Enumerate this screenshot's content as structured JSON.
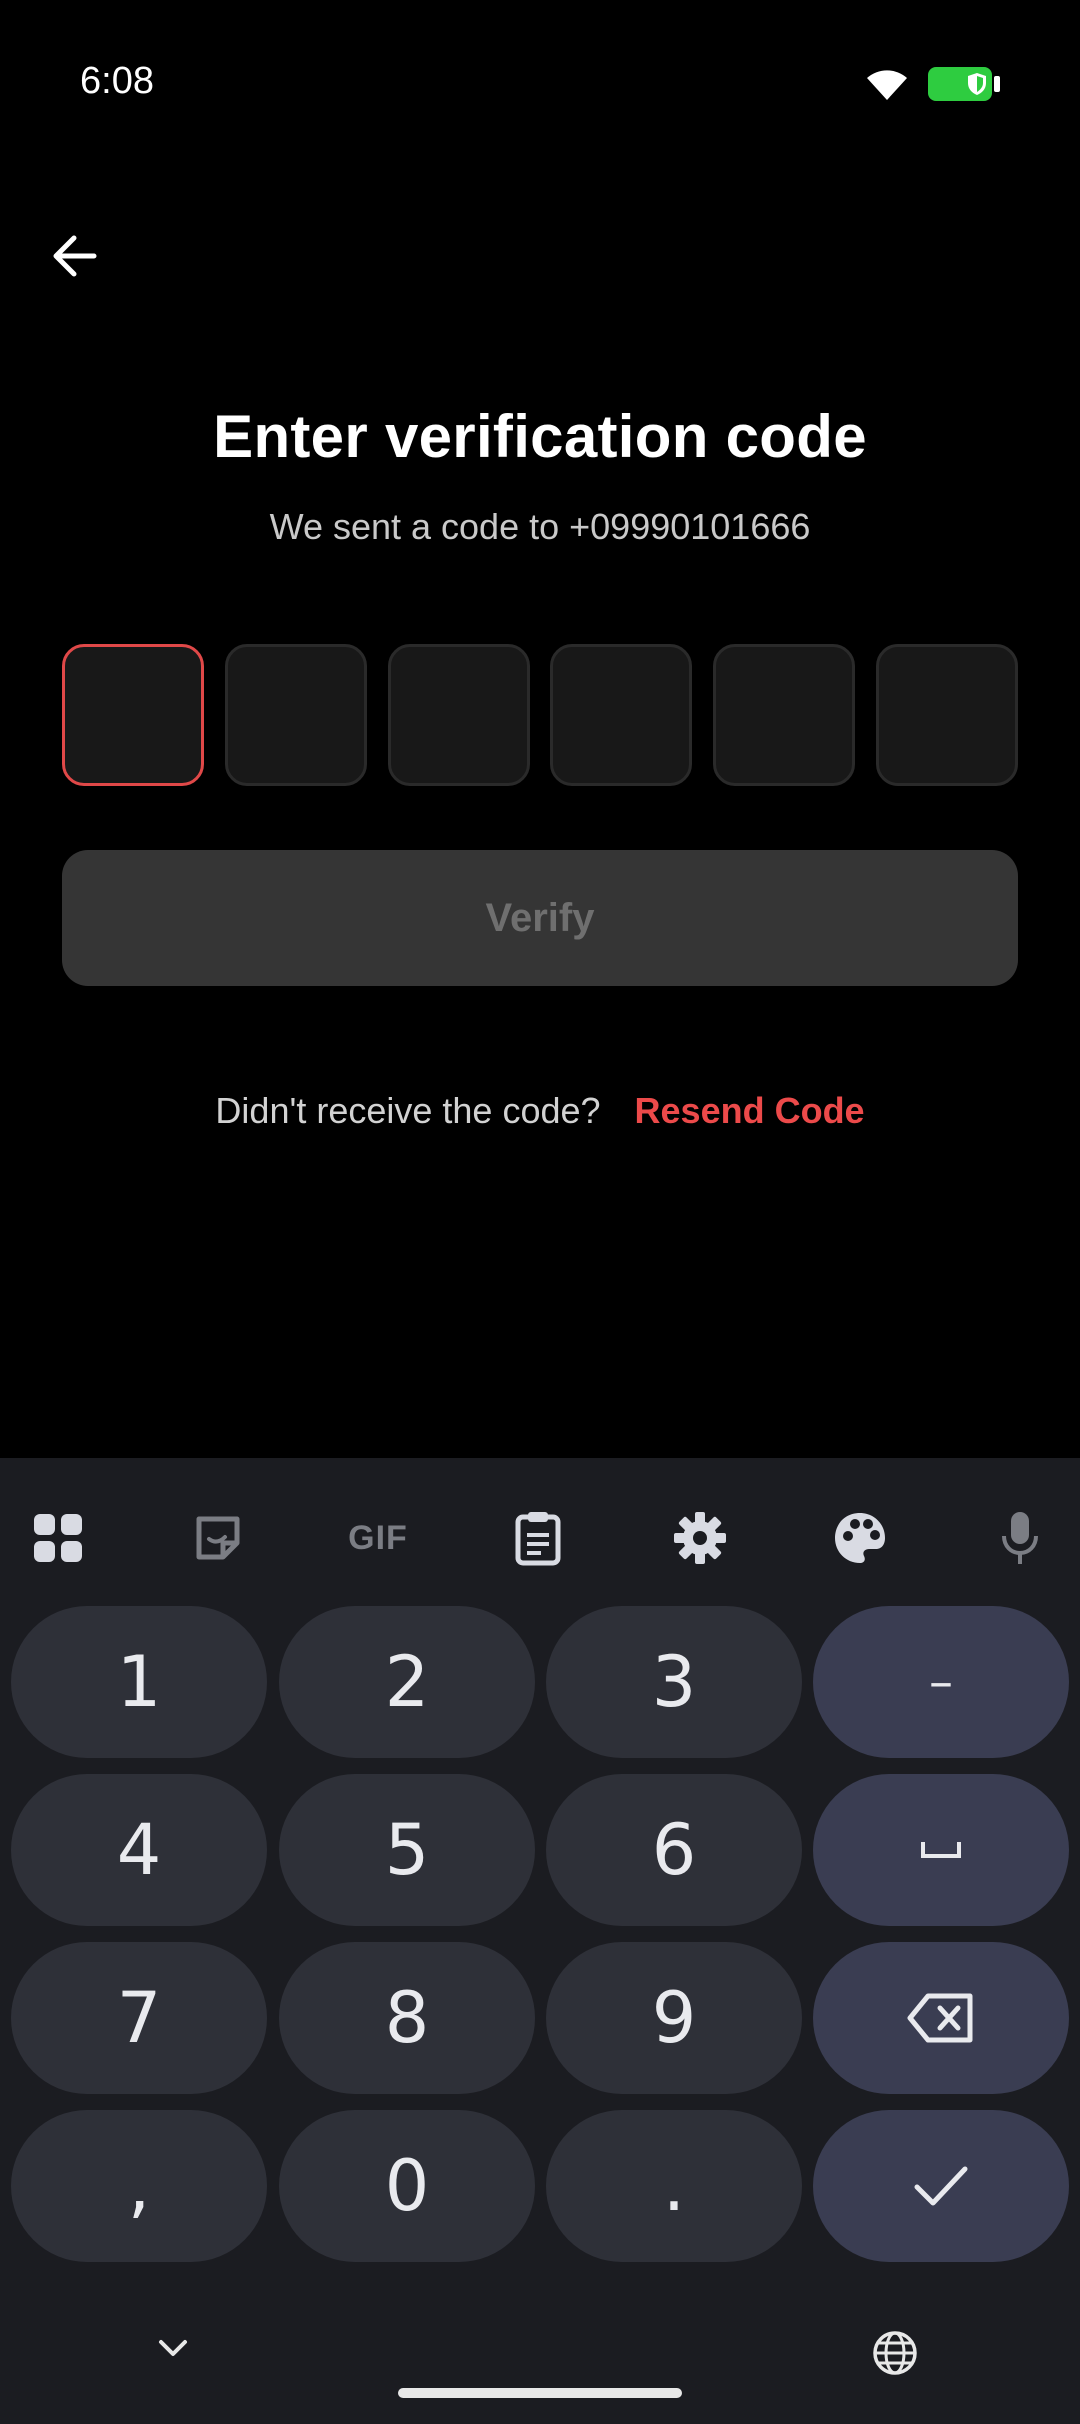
{
  "status": {
    "time": "6:08"
  },
  "screen": {
    "title": "Enter verification code",
    "subtitle": "We sent a code to +09990101666",
    "code_length": 6,
    "verify_label": "Verify",
    "resend_prompt": "Didn't receive the code?",
    "resend_label": "Resend Code"
  },
  "colors": {
    "accent": "#e04848",
    "background": "#000000",
    "keyboard_bg": "#1b1c21"
  },
  "keyboard": {
    "toolbar": [
      "apps-grid-icon",
      "sticker-icon",
      "GIF",
      "clipboard-icon",
      "settings-icon",
      "palette-icon",
      "microphone-icon"
    ],
    "keys": [
      [
        "1",
        "2",
        "3",
        "–"
      ],
      [
        "4",
        "5",
        "6",
        "␣"
      ],
      [
        "7",
        "8",
        "9",
        "⌫"
      ],
      [
        ",",
        "0",
        ".",
        "✓"
      ]
    ]
  }
}
